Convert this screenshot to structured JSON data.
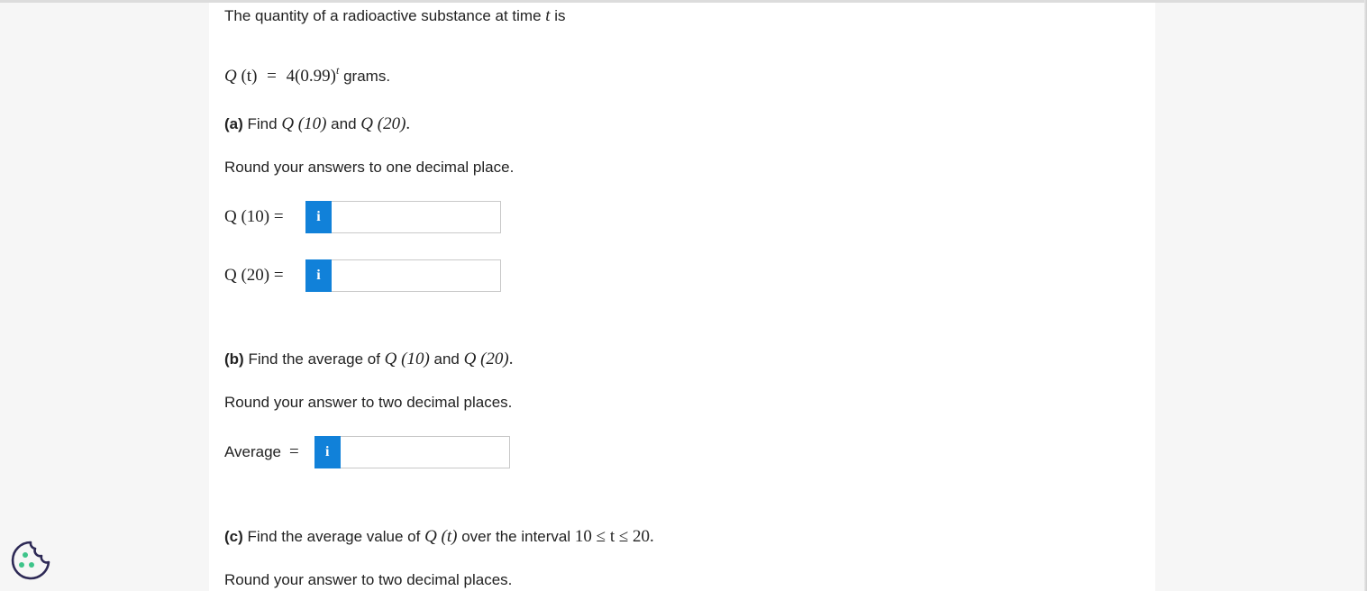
{
  "intro": {
    "text_before": "The quantity of a radioactive substance at time ",
    "var_t": "t",
    "text_after": " is"
  },
  "formula": {
    "lhs_fn": "Q",
    "lhs_arg": " (t)",
    "equals": "=",
    "rhs_coef": "4(0.99)",
    "rhs_exp": "t",
    "unit": " grams."
  },
  "part_a": {
    "tag": "(a)",
    "text1": " Find ",
    "q10": "Q (10)",
    "and": " and ",
    "q20": "Q (20)",
    "end": ".",
    "instruction": "Round your answers to one decimal place.",
    "rows": [
      {
        "label": "Q (10) =",
        "button": "i",
        "value": ""
      },
      {
        "label": "Q (20) =",
        "button": "i",
        "value": ""
      }
    ]
  },
  "part_b": {
    "tag": "(b)",
    "text1": " Find the average of ",
    "q10": "Q (10)",
    "and": " and ",
    "q20": "Q (20)",
    "end": ".",
    "instruction": "Round your answer to two decimal places.",
    "row": {
      "label_text": "Average",
      "label_eq": "=",
      "button": "i",
      "value": ""
    }
  },
  "part_c": {
    "tag": "(c)",
    "text1": " Find the average value of ",
    "qt": "Q (t)",
    "text2": " over the interval ",
    "interval": "10 ≤ t ≤ 20.",
    "instruction": "Round your answer to two decimal places."
  },
  "colors": {
    "info_button": "#1181d9",
    "cookie_outline": "#2e2a56",
    "cookie_dots": "#3ec48a"
  },
  "icons": {
    "info": "info-icon",
    "cookie": "cookie-icon"
  }
}
